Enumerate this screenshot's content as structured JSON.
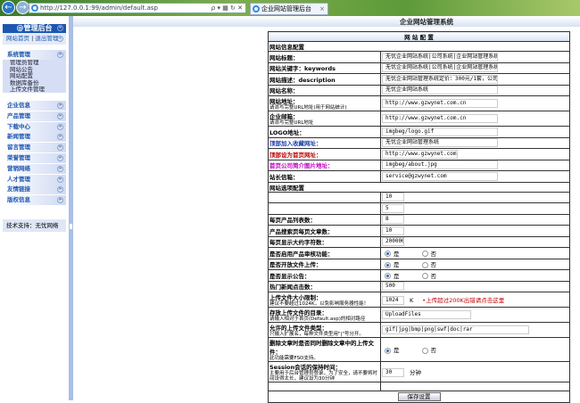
{
  "browser": {
    "url": "http://127.0.0.1:99/admin/default.asp",
    "tab_title": "企业网站管理后台",
    "tools": "ρ ▾ ▦ ↻ ✕",
    "close": "×"
  },
  "sidebar": {
    "title": "@管理后台",
    "home_link": "网站首页",
    "logout_link": "退出管理",
    "sep": "|",
    "system_group": {
      "label": "系统管理",
      "items": [
        "管理员管理",
        "网站公告",
        "网站配置",
        "数据库备份",
        "上传文件管理"
      ]
    },
    "menus": [
      "企业信息",
      "产品管理",
      "下载中心",
      "新闻管理",
      "留言管理",
      "荣誉管理",
      "营销网络",
      "人才管理",
      "友情链接",
      "版权信息"
    ],
    "support": "技术支持：无忧网络"
  },
  "header": {
    "title": "企业网站管理系统"
  },
  "config": {
    "title": "网 站 配 置",
    "save_label": "保存设置",
    "section1": "网站信息配置",
    "section2": "网站选项配置",
    "rows1": [
      {
        "label": "网站标题：",
        "value": "无忧企业网站系统|公司系统|企业网站管理系统",
        "w": 130
      },
      {
        "label": "网站关键字：keywords",
        "value": "无忧企业网站系统|公司系统|企业网站管理系统",
        "w": 130
      },
      {
        "label": "网站描述：description",
        "value": "无忧企业网站管理系统定价：300元/1套，公司网站",
        "w": 130
      },
      {
        "label": "网站名称：",
        "value": "无忧企业网站系统",
        "w": 130
      },
      {
        "label": "网站地址：",
        "hint": "请添写完整URL地址(用于网站统计)",
        "value": "http://www.gzwynet.com.cn",
        "w": 130
      },
      {
        "label": "企业邮箱：",
        "hint": "请添写完整URL地址",
        "value": "http://www.gzwynet.com.cn",
        "w": 130
      },
      {
        "label": "LOGO地址：",
        "value": "imgbeg/logo.gif",
        "w": 130
      },
      {
        "label": "顶部加入收藏网址：",
        "value": "无忧企业网站管理系统",
        "w": 130,
        "color": "#1c3fa8"
      },
      {
        "label": "顶部设为首页网址：",
        "value": "http://www.gzwynet.com.cn",
        "w": 85,
        "color": "#c00000"
      },
      {
        "label": "首页公司简介图片地址：",
        "value": "imgbeg/about.jpg",
        "w": 130,
        "color": "#c000c0"
      },
      {
        "label": "站长信箱：",
        "value": "service@gzwynet.com",
        "w": 130
      }
    ],
    "rows2": [
      {
        "label": "",
        "value": "10",
        "w": 25
      },
      {
        "label": "",
        "value": "5",
        "w": 25
      },
      {
        "label": "每页产品列表数：",
        "value": "8",
        "w": 25
      },
      {
        "label": "产品搜索页每页文章数：",
        "value": "10",
        "w": 25
      },
      {
        "label": "每页显示大约字符数：",
        "value": "200000",
        "w": 25
      },
      {
        "label": "是否启用产品审核功能：",
        "radio": true
      },
      {
        "label": "是否开放文件上传：",
        "radio": true
      },
      {
        "label": "是否显示公告：",
        "radio": true
      },
      {
        "label": "热门新闻点击数：",
        "value": "500",
        "w": 25
      },
      {
        "label": "上传文件大小限制：",
        "hint": "建议不要超过1024K，以免影响服务器性能！",
        "value": "1024",
        "w": 25,
        "unit": "K",
        "note": "•上传超过200K出错请点击这里",
        "note_color": "#c00000"
      },
      {
        "label": "存放上传文件的目录：",
        "hint": "请输入相对于首页(Default.asp)的相对路径",
        "value": "UploadFiles",
        "w": 100
      },
      {
        "label": "允许的上传文件类型：",
        "hint": "只输入扩展名，每种文件类型用\"|\"号分开。",
        "value": "gif|jpg|bmp|png|swf|doc|rar",
        "w": 165
      },
      {
        "label": "删除文章时是否同时删除文章中的上传文件：",
        "hint": "此功能需要FSO支持。",
        "radio": true
      },
      {
        "label": "Session会话的保持时间：",
        "hint": "主要用于后台管理员登录，为了安全，请不要将时间设得太长，建议设为30分钟",
        "value": "30",
        "w": 25,
        "unit": "分钟"
      }
    ],
    "yes": "是",
    "no": "否"
  }
}
